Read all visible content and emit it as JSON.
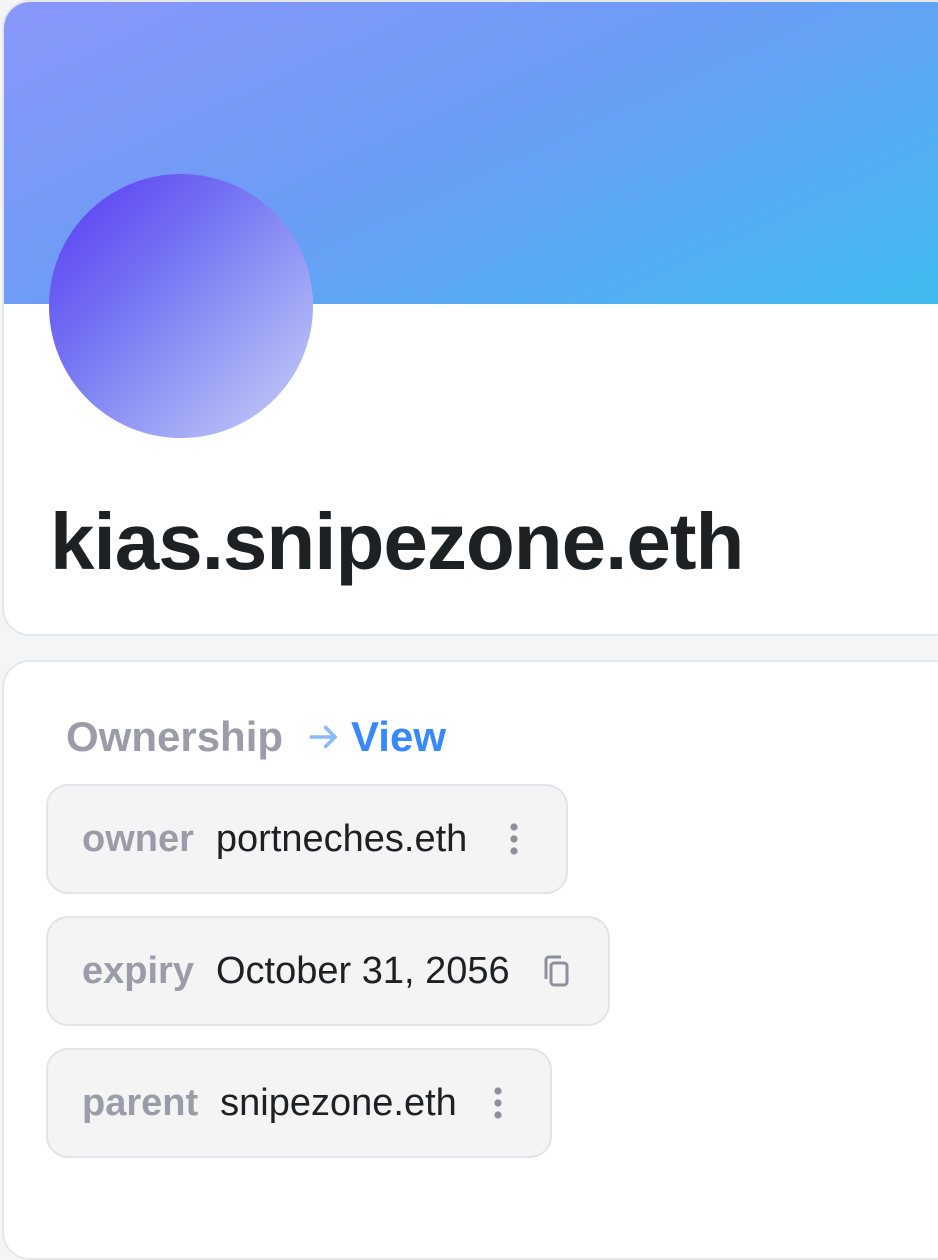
{
  "profile": {
    "name": "kias.snipezone.eth"
  },
  "ownership": {
    "title": "Ownership",
    "view_label": "View",
    "records": [
      {
        "key": "owner",
        "value": "portneches.eth",
        "action_icon": "more-vertical-icon"
      },
      {
        "key": "expiry",
        "value": "October 31, 2056",
        "action_icon": "copy-icon"
      },
      {
        "key": "parent",
        "value": "snipezone.eth",
        "action_icon": "more-vertical-icon"
      }
    ]
  },
  "colors": {
    "banner_start": "#8a97fb",
    "banner_end": "#3fbcf0",
    "avatar_start": "#5638f3",
    "avatar_end": "#c9d3f7",
    "link": "#3889ff",
    "muted": "#9b9ca8",
    "text": "#1e2124"
  }
}
